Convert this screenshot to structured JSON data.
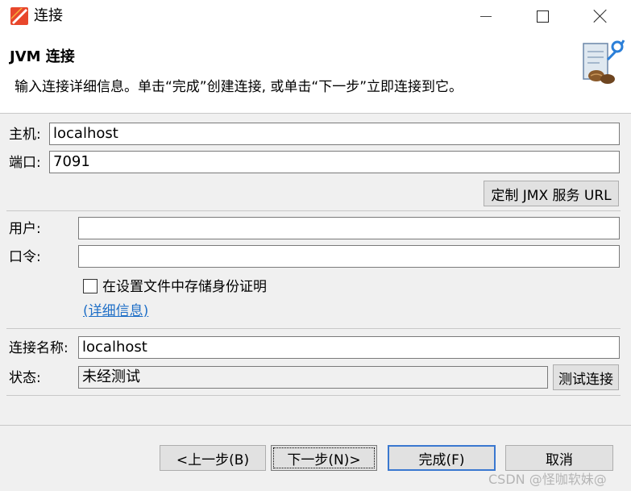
{
  "window": {
    "title": "连接",
    "minimize_label": "",
    "maximize_label": "",
    "close_label": ""
  },
  "header": {
    "title": "JVM 连接",
    "description": "输入连接详细信息。单击“完成”创建连接, 或单击“下一步”立即连接到它。"
  },
  "form": {
    "host_label": "主机:",
    "host_value": "localhost",
    "port_label": "端口:",
    "port_value": "7091",
    "custom_jmx_button": "定制 JMX 服务 URL",
    "user_label": "用户:",
    "user_value": "",
    "password_label": "口令:",
    "password_value": "",
    "remember_label": "在设置文件中存储身份证明",
    "remember_checked": false,
    "details_link": "(详细信息)",
    "connection_name_label": "连接名称:",
    "connection_name_value": "localhost",
    "status_label": "状态:",
    "status_value": "未经测试",
    "test_button": "测试连接"
  },
  "footer": {
    "back_button": "<上一步(B)",
    "next_button": "下一步(N)>",
    "finish_button": "完成(F)",
    "cancel_button": "取消"
  },
  "watermark": "CSDN @怪咖软妹@",
  "colors": {
    "link": "#1f6fc7",
    "default_button_border": "#3a78d0",
    "background": "#f0f0f0"
  },
  "icons": {
    "app": "jmc-app-icon",
    "header_logo": "jvm-connection-plug-icon"
  }
}
